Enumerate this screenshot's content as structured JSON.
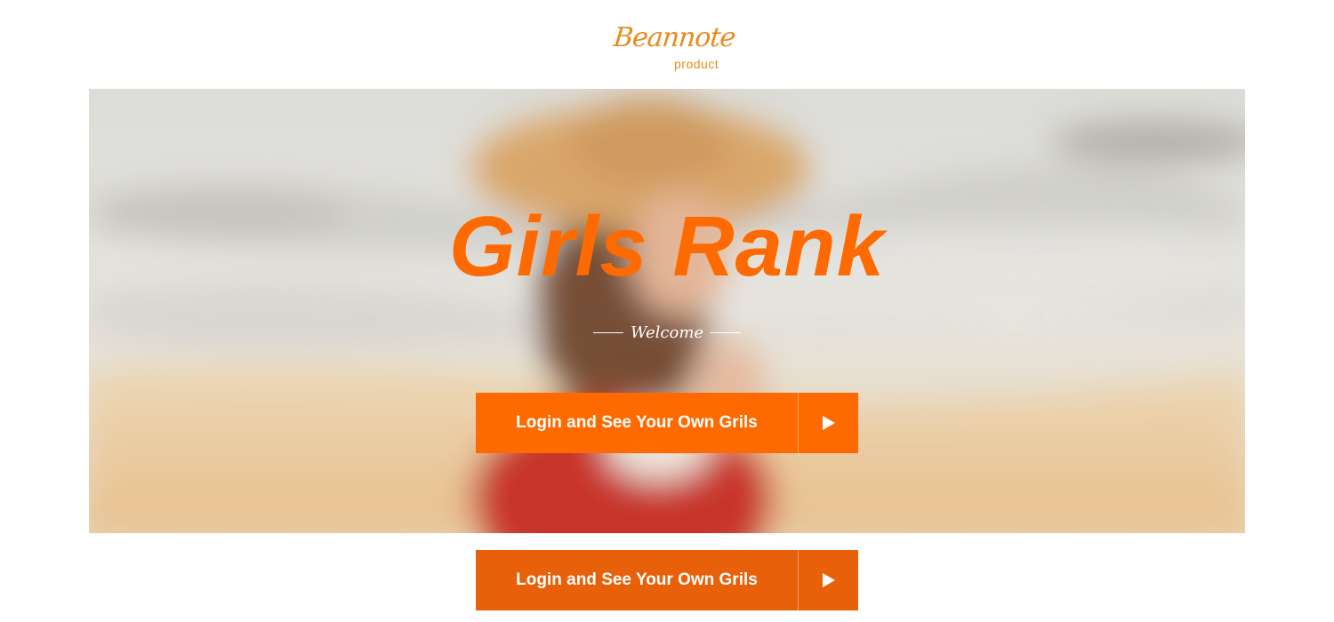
{
  "logo": {
    "brand": "Beannote",
    "sub": "product"
  },
  "hero": {
    "title": "Girls Rank",
    "welcome": "Welcome"
  },
  "cta_primary": {
    "label": "Login and See Your Own Grils",
    "icon": "play-arrow-icon"
  },
  "cta_secondary": {
    "label": "Login and See Your Own Grils",
    "icon": "play-arrow-icon"
  },
  "colors": {
    "accent": "#ff6a00",
    "accent_dark": "#e8610a",
    "logo": "#e98a1d"
  }
}
